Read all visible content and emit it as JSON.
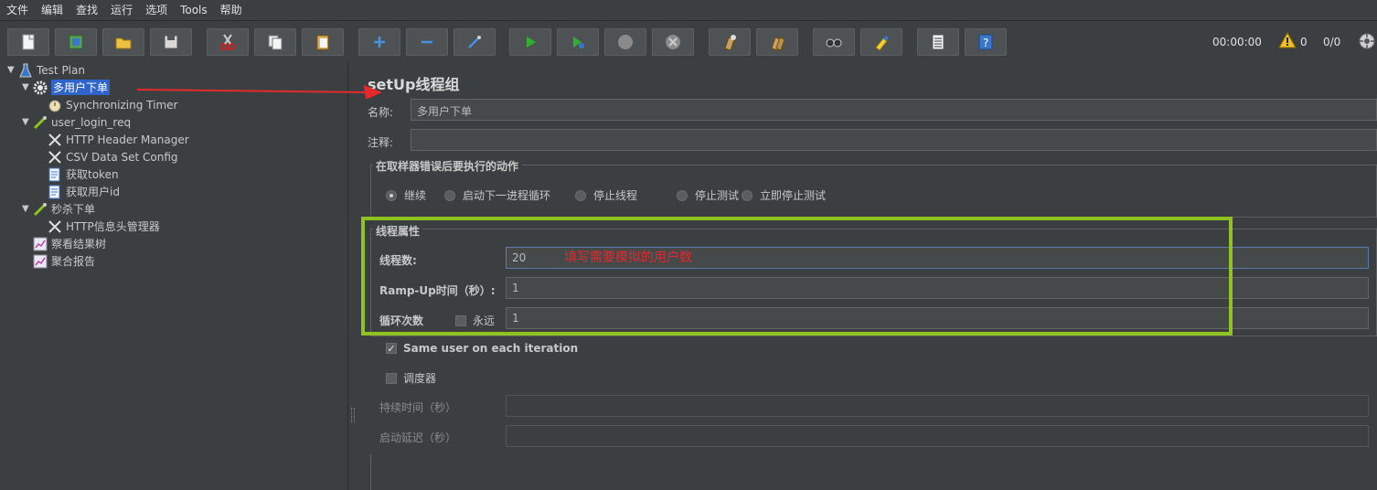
{
  "menu": [
    "文件",
    "编辑",
    "查找",
    "运行",
    "选项",
    "Tools",
    "帮助"
  ],
  "toolbar": {
    "buttons": [
      "new-icon",
      "templates-icon",
      "open-icon",
      "save-icon",
      "cut-icon",
      "copy-icon",
      "paste-icon",
      "expand-icon",
      "collapse-icon",
      "toggle-icon",
      "start-icon",
      "start-no-pause-icon",
      "stop-icon",
      "shutdown-icon",
      "clear-icon",
      "clear-all-icon",
      "search-icon",
      "reset-search-icon",
      "function-helper-icon",
      "help-icon"
    ],
    "timer": "00:00:00",
    "warnings": "0",
    "threads": "0/0"
  },
  "tree": [
    {
      "label": "Test Plan",
      "icon": "flask-icon",
      "level": 0,
      "arrow": "▼"
    },
    {
      "label": "多用户下单",
      "icon": "gear-icon",
      "level": 1,
      "arrow": "▼",
      "selected": true
    },
    {
      "label": "Synchronizing Timer",
      "icon": "timer-icon",
      "level": 2,
      "arrow": ""
    },
    {
      "label": "user_login_req",
      "icon": "sampler-icon",
      "level": 1,
      "arrow": "▼"
    },
    {
      "label": "HTTP Header Manager",
      "icon": "tools-icon",
      "level": 2,
      "arrow": ""
    },
    {
      "label": "CSV Data Set Config",
      "icon": "tools-icon",
      "level": 2,
      "arrow": ""
    },
    {
      "label": "获取token",
      "icon": "extractor-icon",
      "level": 2,
      "arrow": ""
    },
    {
      "label": "获取用户id",
      "icon": "extractor-icon",
      "level": 2,
      "arrow": ""
    },
    {
      "label": "秒杀下单",
      "icon": "sampler-icon",
      "level": 1,
      "arrow": "▼"
    },
    {
      "label": "HTTP信息头管理器",
      "icon": "tools-icon",
      "level": 2,
      "arrow": ""
    },
    {
      "label": "察看结果树",
      "icon": "listener-icon",
      "level": 1,
      "arrow": ""
    },
    {
      "label": "聚合报告",
      "icon": "listener-icon",
      "level": 1,
      "arrow": ""
    }
  ],
  "panel": {
    "title": "setUp线程组",
    "name_label": "名称:",
    "name_value": "多用户下单",
    "comment_label": "注释:",
    "comment_value": "",
    "error_group_title": "在取样器错误后要执行的动作",
    "error_actions": [
      "继续",
      "启动下一进程循环",
      "停止线程",
      "停止测试",
      "立即停止测试"
    ],
    "error_action_selected": 0,
    "thread_group_title": "线程属性",
    "threads_label": "线程数:",
    "threads_value": "20",
    "rampup_label": "Ramp-Up时间（秒）:",
    "rampup_value": "1",
    "loop_label": "循环次数",
    "forever_label": "永远",
    "forever_checked": false,
    "loop_value": "1",
    "same_user_label": "Same user on each iteration",
    "same_user_checked": true,
    "scheduler_label": "调度器",
    "scheduler_checked": false,
    "duration_label": "持续时间（秒）",
    "duration_value": "",
    "delay_label": "启动延迟（秒）",
    "delay_value": ""
  },
  "annotation": "填写需要模拟的用户数",
  "colors": {
    "highlight": "#8fc31f",
    "annotation": "#e4292c",
    "selection": "#2f65ca"
  }
}
